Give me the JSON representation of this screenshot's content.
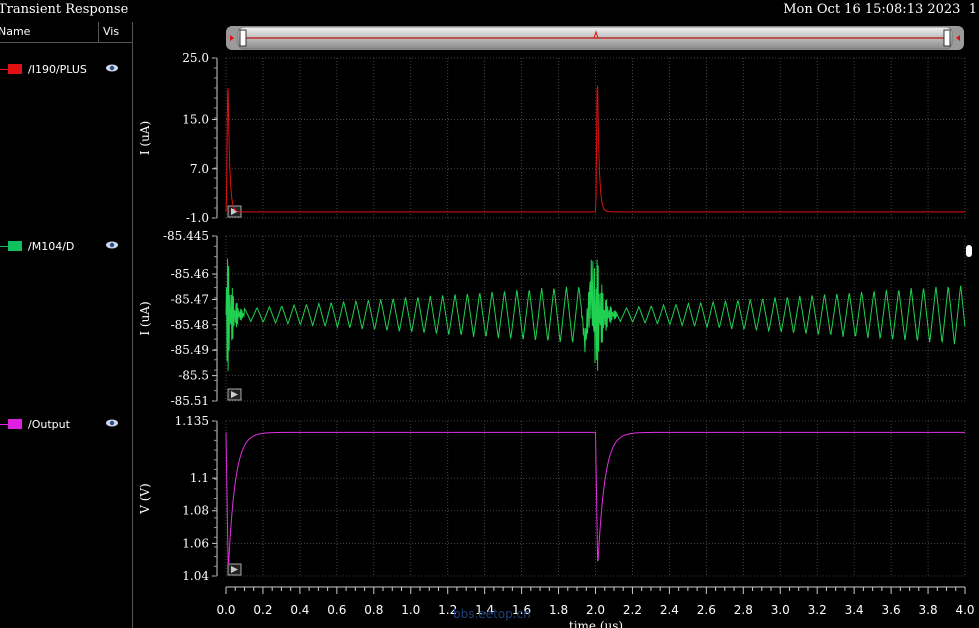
{
  "window": {
    "title": "Transient Response",
    "datetime": "Mon Oct 16 15:08:13 2023",
    "trailing": "1"
  },
  "legend": {
    "header_name": "Name",
    "header_vis": "Vis",
    "items": [
      {
        "label": "/I190/PLUS",
        "color": "#e01010",
        "visible_icon": "eye-icon"
      },
      {
        "label": "/M104/D",
        "color": "#10c060",
        "visible_icon": "eye-icon"
      },
      {
        "label": "/Output",
        "color": "#e020e0",
        "visible_icon": "eye-icon"
      }
    ]
  },
  "chart_data": {
    "type": "line",
    "xlabel": "time (us)",
    "xlim": [
      0.0,
      4.0
    ],
    "xticks": [
      "0.0",
      "0.2",
      "0.4",
      "0.6",
      "0.8",
      "1.0",
      "1.2",
      "1.4",
      "1.6",
      "1.8",
      "2.0",
      "2.2",
      "2.4",
      "2.6",
      "2.8",
      "3.0",
      "3.2",
      "3.4",
      "3.6",
      "3.8",
      "4.0"
    ],
    "background": "#000000",
    "grid": true,
    "grid_color": "#555555",
    "subplots": [
      {
        "series_name": "/I190/PLUS",
        "ylabel": "I (uA)",
        "ylim": [
          -1.0,
          25.0
        ],
        "yticks": [
          "25.0",
          "15.0",
          "7.0",
          "-1.0"
        ],
        "color": "#e01010",
        "baseline": 0.0,
        "spikes": [
          {
            "t": 0.01,
            "peak": 23.5,
            "decay_us": 0.02
          },
          {
            "t": 2.01,
            "peak": 24.0,
            "decay_us": 0.02
          }
        ]
      },
      {
        "series_name": "/M104/D",
        "ylabel": "I (uA)",
        "ylim": [
          -85.51,
          -85.445
        ],
        "yticks": [
          "-85.445",
          "-85.46",
          "-85.47",
          "-85.48",
          "-85.49",
          "-85.5",
          "-85.51"
        ],
        "color": "#20d050",
        "center": -85.476,
        "ring_events": [
          {
            "t": 0.0,
            "amplitude": 0.032,
            "ring_end": 0.1
          },
          {
            "t": 2.0,
            "amplitude": 0.03,
            "ring_end": 2.12
          }
        ],
        "triangle_amp_start": 0.002,
        "triangle_amp_end": 0.012,
        "triangle_period_us": 0.067
      },
      {
        "series_name": "/Output",
        "ylabel": "V (V)",
        "ylim": [
          1.04,
          1.135
        ],
        "yticks": [
          "1.135",
          "1.1",
          "1.08",
          "1.06",
          "1.04"
        ],
        "color": "#e030e0",
        "steady": 1.128,
        "dips": [
          {
            "t": 0.0,
            "min": 1.043,
            "recovery_us": 0.06
          },
          {
            "t": 2.0,
            "min": 1.045,
            "recovery_us": 0.06
          }
        ]
      }
    ]
  },
  "watermark": "bbs.eetop.cn"
}
